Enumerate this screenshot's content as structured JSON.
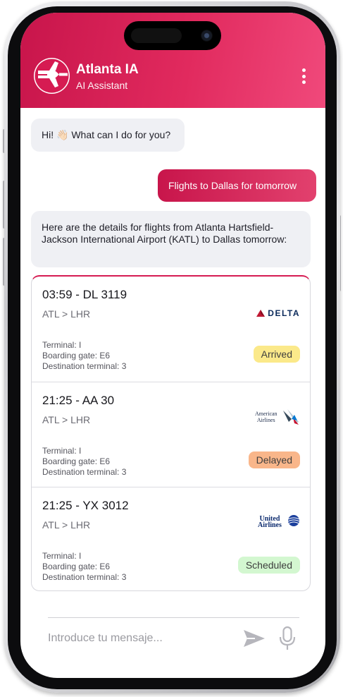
{
  "header": {
    "app_title": "Atlanta IA",
    "app_subtitle": "AI Assistant",
    "gradient_start": "#c8154b",
    "gradient_end": "#f0497b"
  },
  "chat": {
    "greeting": "Hi! 👋🏻 What can I do for you?",
    "user_message": "Flights to Dallas for tomorrow",
    "bot_reply": "Here are the details for flights from Atlanta Hartsfield-Jackson International Airport (KATL) to Dallas tomorrow:"
  },
  "flights": [
    {
      "time_flight": "03:59 - DL 3119",
      "route": "ATL > LHR",
      "terminal": "Terminal: I",
      "gate": "Boarding gate: E6",
      "dest_terminal": "Destination terminal: 3",
      "airline_logo": "DELTA",
      "status": "Arrived",
      "status_bg": "#fbe98a"
    },
    {
      "time_flight": "21:25 - AA 30",
      "route": "ATL > LHR",
      "terminal": "Terminal: I",
      "gate": "Boarding gate: E6",
      "dest_terminal": "Destination terminal: 3",
      "airline_logo_line1": "American",
      "airline_logo_line2": "Airlines",
      "status": "Delayed",
      "status_bg": "#f9b68a"
    },
    {
      "time_flight": "21:25 - YX 3012",
      "route": "ATL > LHR",
      "terminal": "Terminal: I",
      "gate": "Boarding gate: E6",
      "dest_terminal": "Destination terminal: 3",
      "airline_logo_line1": "United",
      "airline_logo_line2": "Airlines",
      "status": "Scheduled",
      "status_bg": "#d3f7d0"
    }
  ],
  "composer": {
    "placeholder": "Introduce tu mensaje..."
  },
  "icons": {
    "menu": "kebab-menu-icon",
    "send": "send-icon",
    "mic": "microphone-icon"
  }
}
